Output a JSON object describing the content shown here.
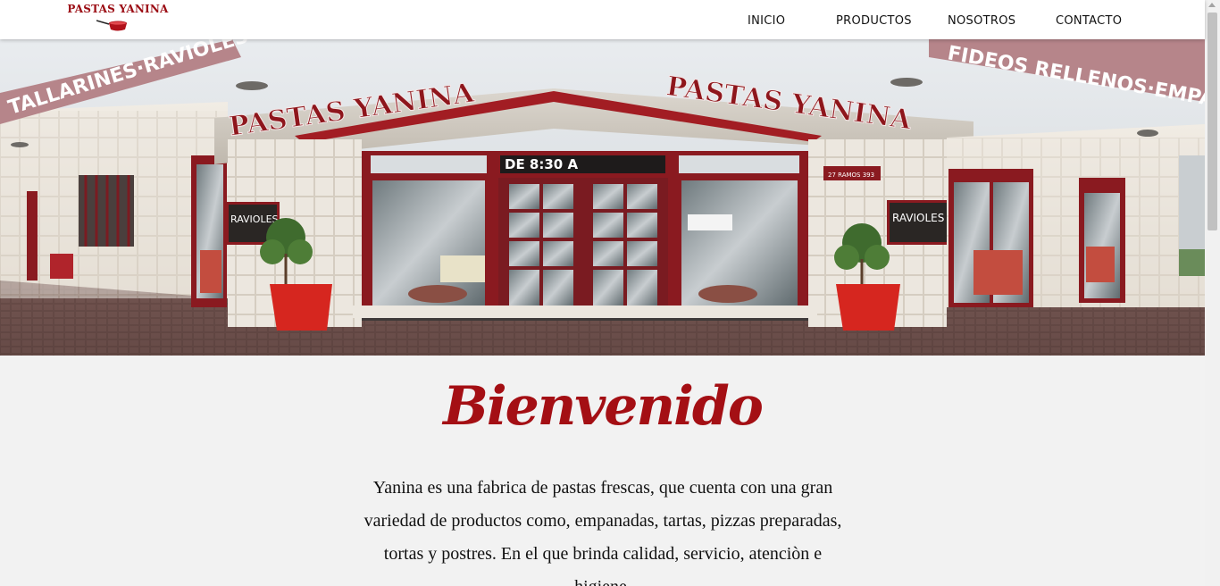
{
  "brand": {
    "name": "PASTAS YANINA",
    "color": "#9b0d14"
  },
  "nav": {
    "items": [
      {
        "label": "INICIO"
      },
      {
        "label": "PRODUCTOS"
      },
      {
        "label": "NOSOTROS"
      },
      {
        "label": "CONTACTO"
      }
    ]
  },
  "hero": {
    "sign_text": "PASTAS YANINA",
    "hours_text": "DE 8:30 A",
    "street_number_text": "27 RAMOS 393",
    "board_text": "RAVIOLES",
    "awning_left_text": "TALLARINES·RAVIOLES",
    "awning_right_text": "FIDEOS RELLENOS·EMPANA"
  },
  "welcome": {
    "heading": "Bienvenido",
    "text": "Yanina es una fabrica de pastas frescas, que cuenta con una gran variedad de productos como, empanadas, tartas, pizzas preparadas, tortas y postres. En el que brinda calidad, servicio, atenciòn e higiene."
  },
  "colors": {
    "accent": "#a40f14",
    "background": "#f2f2f2",
    "frame_red": "#8a1a20"
  }
}
